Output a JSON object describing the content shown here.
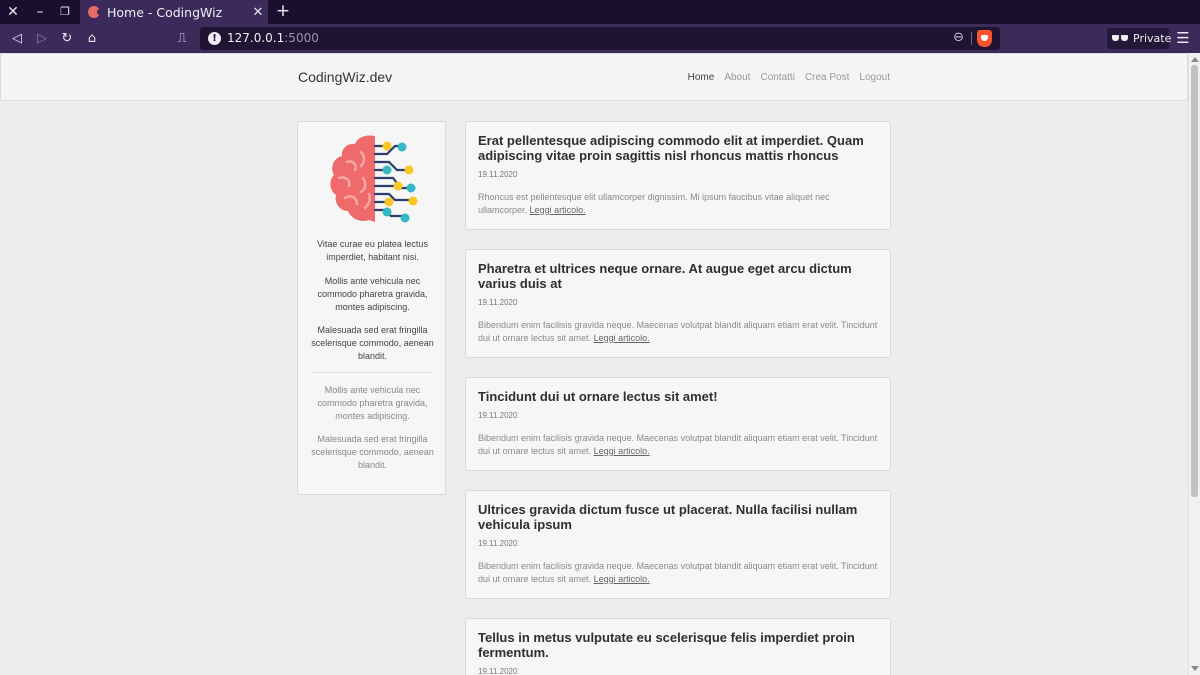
{
  "browser": {
    "tab_title": "Home - CodingWiz",
    "url_host": "127.0.0.1",
    "url_port": ":5000",
    "private_label": "Private"
  },
  "site": {
    "brand": "CodingWiz.dev",
    "nav": [
      {
        "label": "Home",
        "active": true
      },
      {
        "label": "About"
      },
      {
        "label": "Contatti"
      },
      {
        "label": "Crea Post"
      },
      {
        "label": "Logout"
      }
    ]
  },
  "sidebar": {
    "paragraphs": [
      "Vitae curae eu platea lectus imperdiet, habitant nisi.",
      "Mollis ante vehicula nec commodo pharetra gravida, montes adipiscing.",
      "Malesuada sed erat fringilla scelerisque commodo, aenean blandit.",
      "Mollis ante vehicula nec commodo pharetra gravida, montes adipiscing.",
      "Malesuada sed erat fringilla scelerisque commodo, aenean blandit."
    ]
  },
  "posts": [
    {
      "title": "Erat pellentesque adipiscing commodo elit at imperdiet. Quam adipiscing vitae proin sagittis nisl rhoncus mattis rhoncus",
      "date": "19.11.2020",
      "excerpt": "Rhoncus est pellentesque elit ullamcorper dignissim. Mi ipsum faucibus vitae aliquet nec ullamcorper.",
      "read_more": "Leggi articolo."
    },
    {
      "title": "Pharetra et ultrices neque ornare. At augue eget arcu dictum varius duis at",
      "date": "19.11.2020",
      "excerpt": "Bibendum enim facilisis gravida neque. Maecenas volutpat blandit aliquam etiam erat velit. Tincidunt dui ut ornare lectus sit amet.",
      "read_more": "Leggi articolo."
    },
    {
      "title": "Tincidunt dui ut ornare lectus sit amet!",
      "date": "19.11.2020",
      "excerpt": "Bibendum enim facilisis gravida neque. Maecenas volutpat blandit aliquam etiam erat velit. Tincidunt dui ut ornare lectus sit amet.",
      "read_more": "Leggi articolo."
    },
    {
      "title": "Ultrices gravida dictum fusce ut placerat. Nulla facilisi nullam vehicula ipsum",
      "date": "19.11.2020",
      "excerpt": "Bibendum enim facilisis gravida neque. Maecenas volutpat blandit aliquam etiam erat velit. Tincidunt dui ut ornare lectus sit amet.",
      "read_more": "Leggi articolo."
    },
    {
      "title": "Tellus in metus vulputate eu scelerisque felis imperdiet proin fermentum.",
      "date": "19.11.2020",
      "excerpt": "",
      "read_more": ""
    }
  ],
  "icons": {
    "window": [
      "close-icon",
      "minimize-icon",
      "restore-icon"
    ],
    "nav": [
      "back-icon",
      "forward-icon",
      "reload-icon",
      "home-icon",
      "bookmark-icon"
    ],
    "url": [
      "info-icon",
      "zoom-icon",
      "brave-shield-icon"
    ],
    "menu": "hamburger-menu-icon"
  },
  "colors": {
    "chrome_dark": "#1b0f2f",
    "chrome": "#3c2a5a",
    "page_bg": "#ededed",
    "brain_red": "#ef6b6b",
    "circuit_yellow": "#f9c623",
    "circuit_teal": "#36b8c4"
  }
}
